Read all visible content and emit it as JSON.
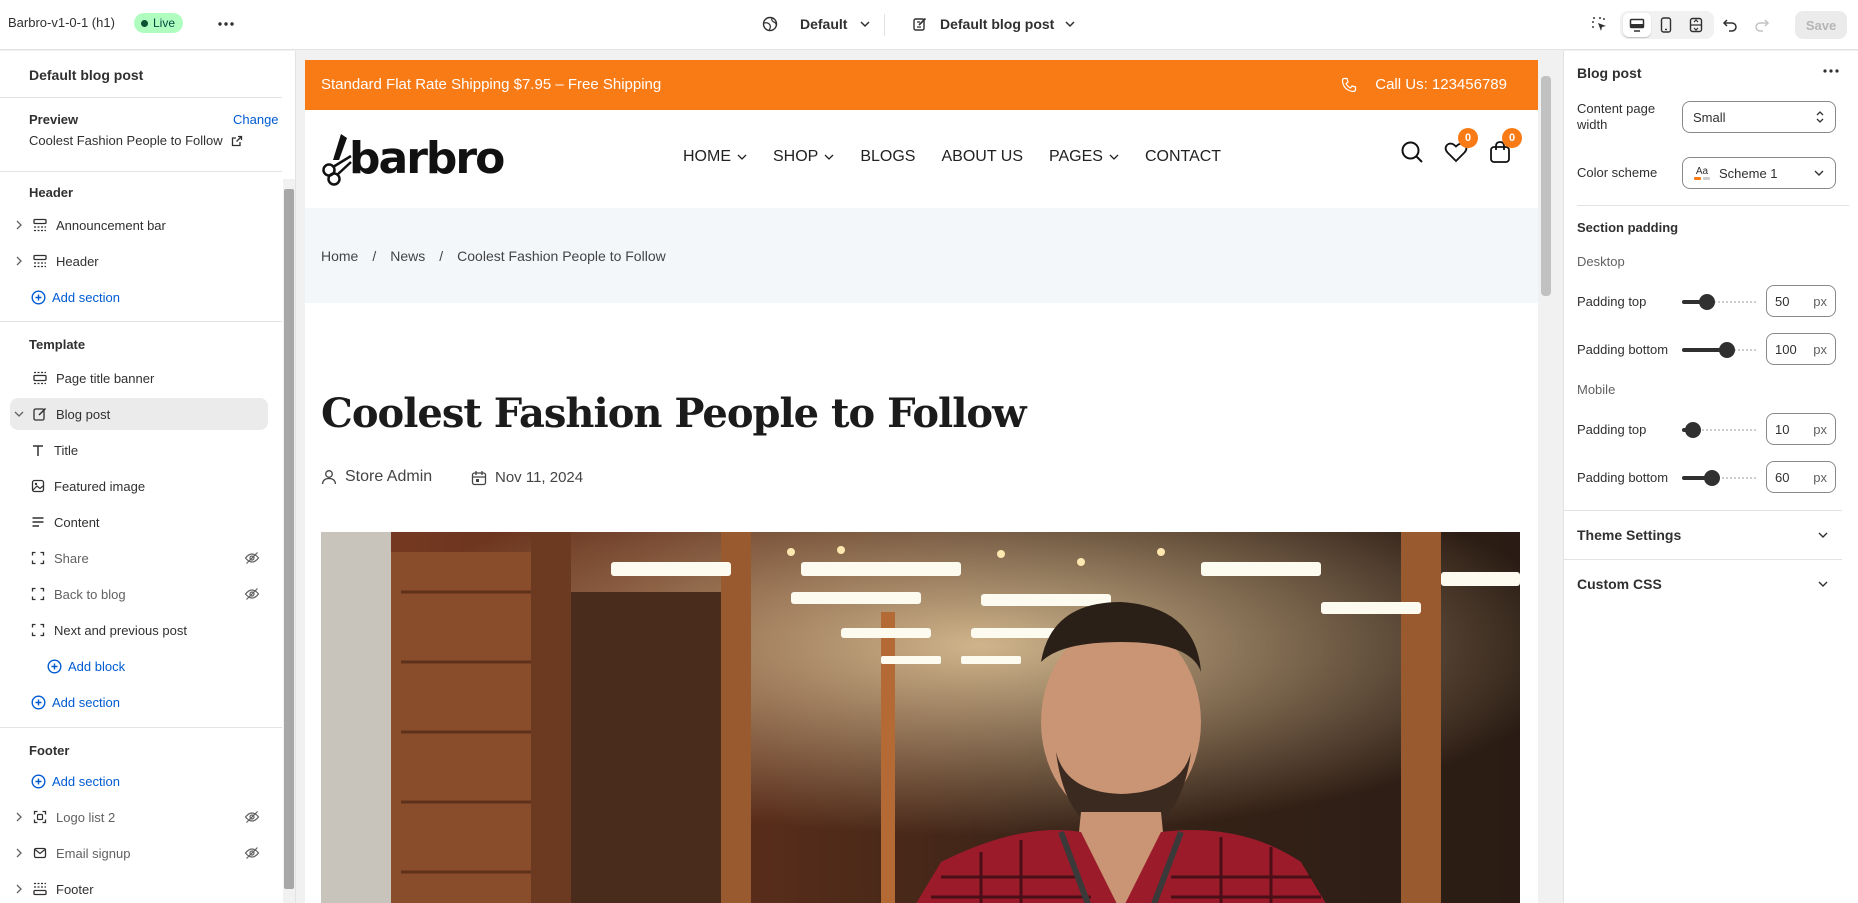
{
  "topbar": {
    "theme_name": "Barbro-v1-0-1 (h1)",
    "status": "Live",
    "locale_label": "Default",
    "template_label": "Default blog post",
    "save_label": "Save"
  },
  "left_panel": {
    "title": "Default blog post",
    "preview_label": "Preview",
    "change_label": "Change",
    "preview_item": "Coolest Fashion People to Follow",
    "header_group": "Header",
    "header_items": [
      "Announcement bar",
      "Header"
    ],
    "add_section": "Add section",
    "template_group": "Template",
    "template_items": [
      "Page title banner",
      "Blog post"
    ],
    "blog_blocks": [
      "Title",
      "Featured image",
      "Content",
      "Share",
      "Back to blog",
      "Next and previous post"
    ],
    "add_block": "Add block",
    "footer_group": "Footer",
    "footer_items": [
      "Logo list 2",
      "Email signup",
      "Footer"
    ]
  },
  "store": {
    "announcement": "Standard Flat Rate Shipping $7.95 – Free Shipping",
    "phone": "Call Us: 123456789",
    "logo": "barbro",
    "nav": [
      "HOME",
      "SHOP",
      "BLOGS",
      "ABOUT US",
      "PAGES",
      "CONTACT"
    ],
    "wishlist_count": "0",
    "cart_count": "0",
    "breadcrumb": [
      "Home",
      "News",
      "Coolest Fashion People to Follow"
    ],
    "breadcrumb_sep": "/",
    "post_title": "Coolest Fashion People to Follow",
    "author": "Store Admin",
    "date": "Nov 11, 2024",
    "accent_color": "#f97b16"
  },
  "right_panel": {
    "title": "Blog post",
    "content_width_label": "Content page width",
    "content_width_value": "Small",
    "color_scheme_label": "Color scheme",
    "color_scheme_value": "Scheme 1",
    "color_scheme_swatch": "Aa",
    "section_padding": "Section padding",
    "desktop": "Desktop",
    "mobile": "Mobile",
    "padding_top": "Padding top",
    "padding_bottom": "Padding bottom",
    "unit": "px",
    "desktop_top": "50",
    "desktop_bottom": "100",
    "mobile_top": "10",
    "mobile_bottom": "60",
    "theme_settings": "Theme Settings",
    "custom_css": "Custom CSS"
  }
}
